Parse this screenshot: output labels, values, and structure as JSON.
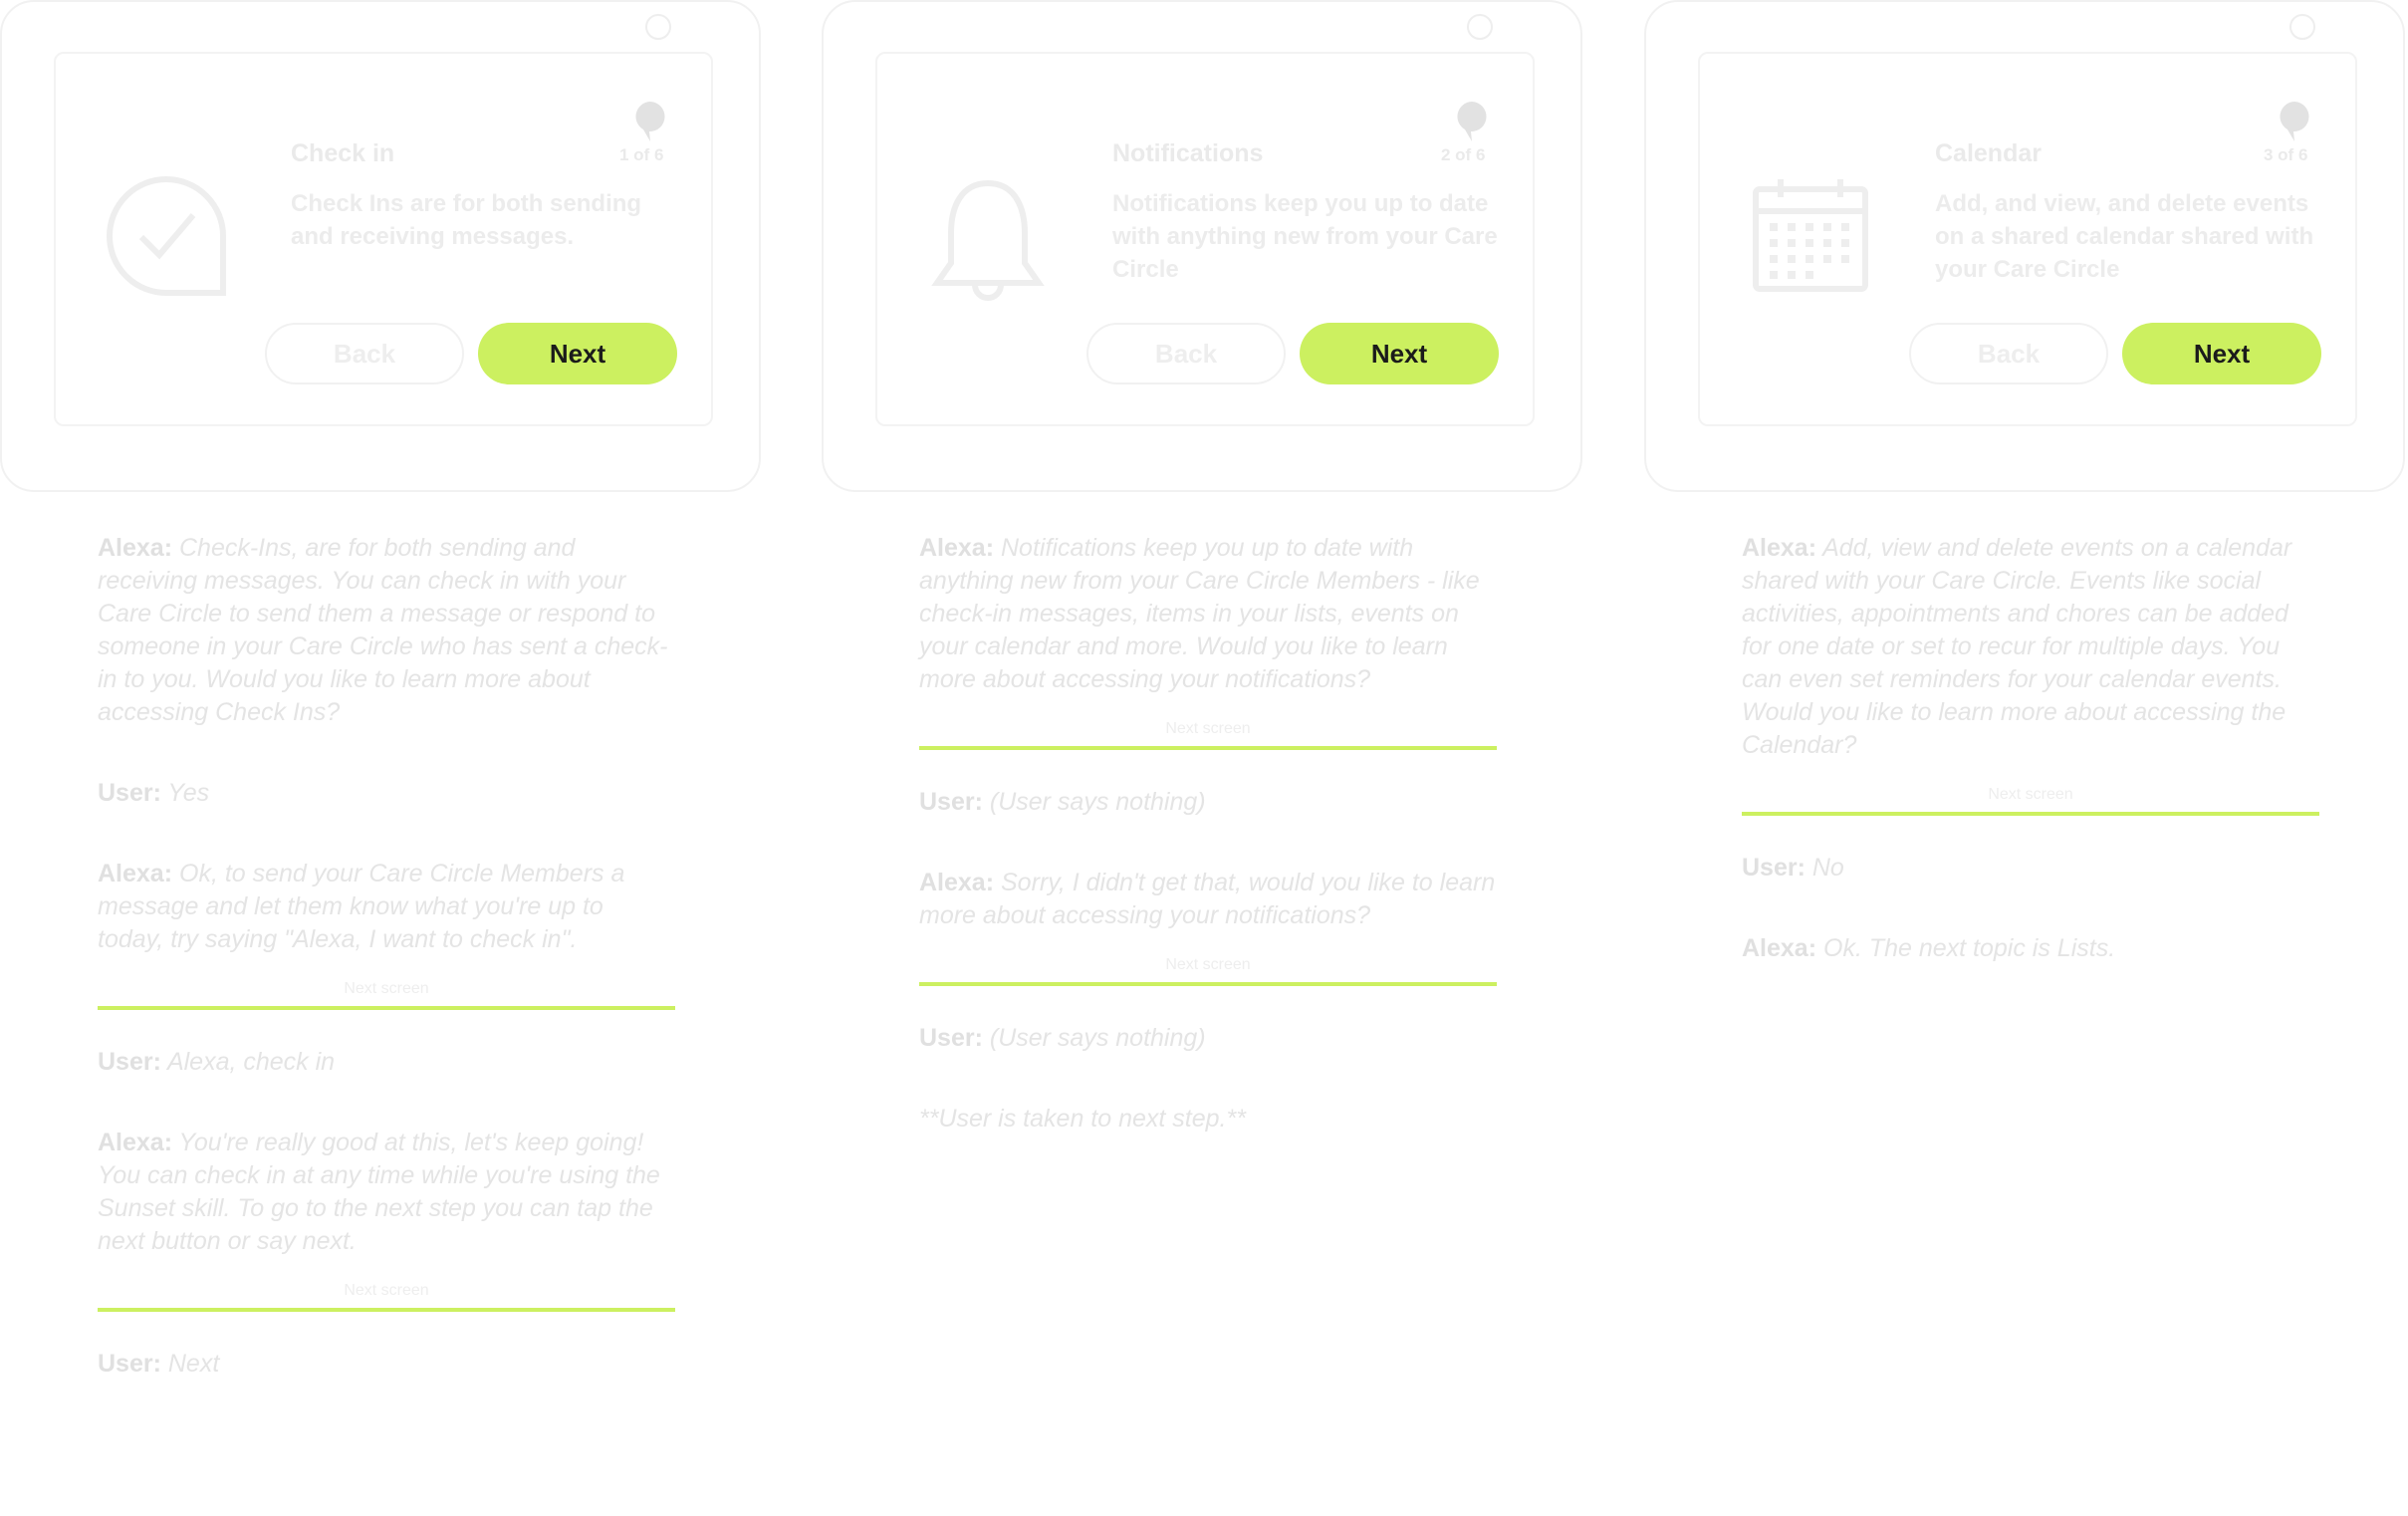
{
  "colors": {
    "accent": "#ccf060",
    "faded_text": "#e6e6e6"
  },
  "cards": [
    {
      "title": "Check in",
      "step": "1 of 6",
      "description": "Check Ins are for both sending and receiving messages.",
      "icon": "checkmark-bubble-icon",
      "back_label": "Back",
      "next_label": "Next"
    },
    {
      "title": "Notifications",
      "step": "2 of 6",
      "description": "Notifications keep you up to date with anything new from your Care Circle",
      "icon": "bell-icon",
      "back_label": "Back",
      "next_label": "Next"
    },
    {
      "title": "Calendar",
      "step": "3 of 6",
      "description": "Add, and view, and delete events on a shared calendar shared with your Care Circle",
      "icon": "calendar-icon",
      "back_label": "Back",
      "next_label": "Next"
    }
  ],
  "scripts": [
    {
      "lines": [
        {
          "speaker": "Alexa:",
          "text": " Check-Ins, are for both sending and receiving messages. You can check in with your Care Circle to send them a message or respond to someone in your Care Circle who has sent a check-in to you. Would you like to learn more about accessing Check Ins?"
        },
        {
          "speaker": "User:",
          "text": " Yes"
        },
        {
          "speaker": "Alexa:",
          "text": " Ok, to send your Care Circle Members a message and let them know what you're up to today, try saying \"Alexa, I want to check in\"."
        },
        {
          "divider": "Next screen"
        },
        {
          "speaker": "User:",
          "text": " Alexa, check in"
        },
        {
          "speaker": "Alexa:",
          "text": " You're really good at this, let's keep going! You can check in at any time while you're using the Sunset skill. To go to the next step you can tap the next button or say next."
        },
        {
          "divider": "Next screen"
        },
        {
          "speaker": "User:",
          "text": " Next"
        }
      ]
    },
    {
      "lines": [
        {
          "speaker": "Alexa:",
          "text": " Notifications keep you up to date with anything new from your Care Circle Members - like check-in messages, items in your lists, events on your calendar and more. Would you like to learn more about accessing your notifications?"
        },
        {
          "divider": "Next screen"
        },
        {
          "speaker": "User:",
          "text": " (User says nothing)"
        },
        {
          "speaker": "Alexa:",
          "text": " Sorry, I didn't get that, would you like to learn more about accessing your notifications?"
        },
        {
          "divider": "Next screen"
        },
        {
          "speaker": "User:",
          "text": " (User says nothing)"
        },
        {
          "speaker": "",
          "text": "**User is taken to next step.**"
        }
      ]
    },
    {
      "lines": [
        {
          "speaker": "Alexa:",
          "text": " Add, view and delete events on a calendar shared with your Care Circle.  Events like social activities, appointments and chores can be added for one date or set to recur for multiple days. You can even set reminders for your calendar events. Would you like to learn more about accessing the Calendar?"
        },
        {
          "divider": "Next screen"
        },
        {
          "speaker": "User:",
          "text": " No"
        },
        {
          "speaker": "Alexa:",
          "text": " Ok. The next topic is Lists."
        }
      ]
    }
  ]
}
